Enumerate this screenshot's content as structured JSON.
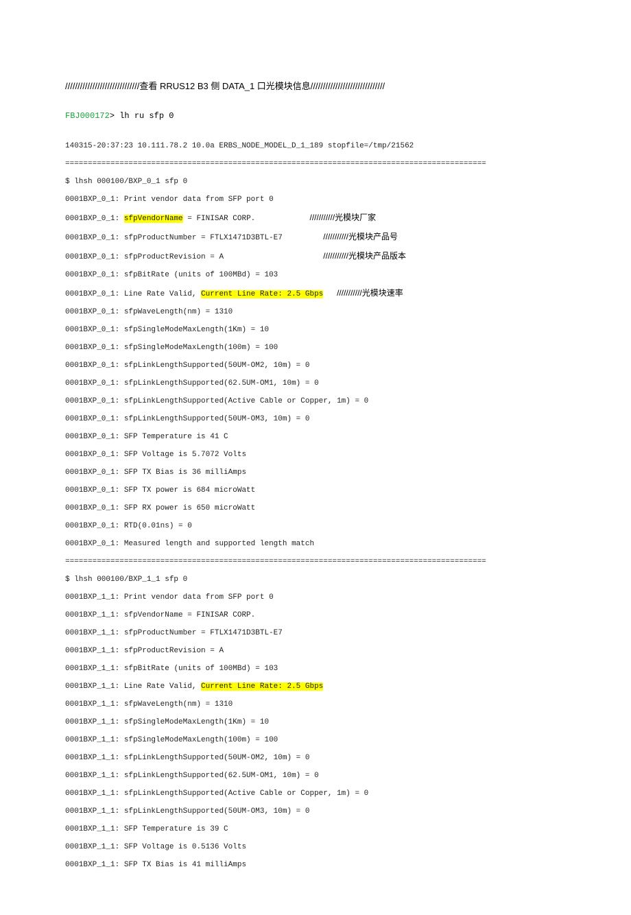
{
  "title": "//////////////////////////////查看 RRUS12 B3 侧 DATA_1 口光模块信息//////////////////////////////",
  "prompt": "FBJ000172",
  "cmd": "> lh ru sfp 0",
  "header": "140315-20:37:23 10.111.78.2 10.0a ERBS_NODE_MODEL_D_1_189 stopfile=/tmp/21562",
  "sep": "=============================================================================================",
  "b1": {
    "cmd": "$ lhsh 000100/BXP_0_1 sfp 0",
    "p": "0001BXP_0_1: ",
    "l1": "Print vendor data from SFP port 0",
    "l2a": "sfpVendorName",
    "l2b": " = FINISAR CORP.            ",
    "c2": "///////////光模块厂家",
    "l3": "sfpProductNumber = FTLX1471D3BTL-E7         ",
    "c3": "///////////光模块产品号",
    "l4": "sfpProductRevision = A                      ",
    "c4": "///////////光模块产品版本",
    "l5": "sfpBitRate (units of 100MBd) = 103",
    "l6a": "Line Rate Valid, ",
    "l6b": "Current Line Rate: 2.5 Gbps",
    "l6c": "   ",
    "c6": "///////////光模块速率",
    "l7": "sfpWaveLength(nm) = 1310",
    "l8": "sfpSingleModeMaxLength(1Km) = 10",
    "l9": "sfpSingleModeMaxLength(100m) = 100",
    "l10": "sfpLinkLengthSupported(50UM-OM2, 10m) = 0",
    "l11": "sfpLinkLengthSupported(62.5UM-OM1, 10m) = 0",
    "l12": "sfpLinkLengthSupported(Active Cable or Copper, 1m) = 0",
    "l13": "sfpLinkLengthSupported(50UM-OM3, 10m) = 0",
    "l14": "SFP Temperature is 41 C",
    "l15": "SFP Voltage is 5.7072 Volts",
    "l16": "SFP TX Bias is 36 milliAmps",
    "l17": "SFP TX power is 684 microWatt",
    "l18": "SFP RX power is 650 microWatt",
    "l19": "RTD(0.01ns) = 0",
    "l20": "Measured length and supported length match"
  },
  "b2": {
    "cmd": "$ lhsh 000100/BXP_1_1 sfp 0",
    "p": "0001BXP_1_1: ",
    "l1": "Print vendor data from SFP port 0",
    "l2": "sfpVendorName = FINISAR CORP.",
    "l3": "sfpProductNumber = FTLX1471D3BTL-E7",
    "l4": "sfpProductRevision = A",
    "l5": "sfpBitRate (units of 100MBd) = 103",
    "l6a": "Line Rate Valid, ",
    "l6b": "Current Line Rate: 2.5 Gbps",
    "l7": "sfpWaveLength(nm) = 1310",
    "l8": "sfpSingleModeMaxLength(1Km) = 10",
    "l9": "sfpSingleModeMaxLength(100m) = 100",
    "l10": "sfpLinkLengthSupported(50UM-OM2, 10m) = 0",
    "l11": "sfpLinkLengthSupported(62.5UM-OM1, 10m) = 0",
    "l12": "sfpLinkLengthSupported(Active Cable or Copper, 1m) = 0",
    "l13": "sfpLinkLengthSupported(50UM-OM3, 10m) = 0",
    "l14": "SFP Temperature is 39 C",
    "l15": "SFP Voltage is 0.5136 Volts",
    "l16": "SFP TX Bias is 41 milliAmps"
  }
}
